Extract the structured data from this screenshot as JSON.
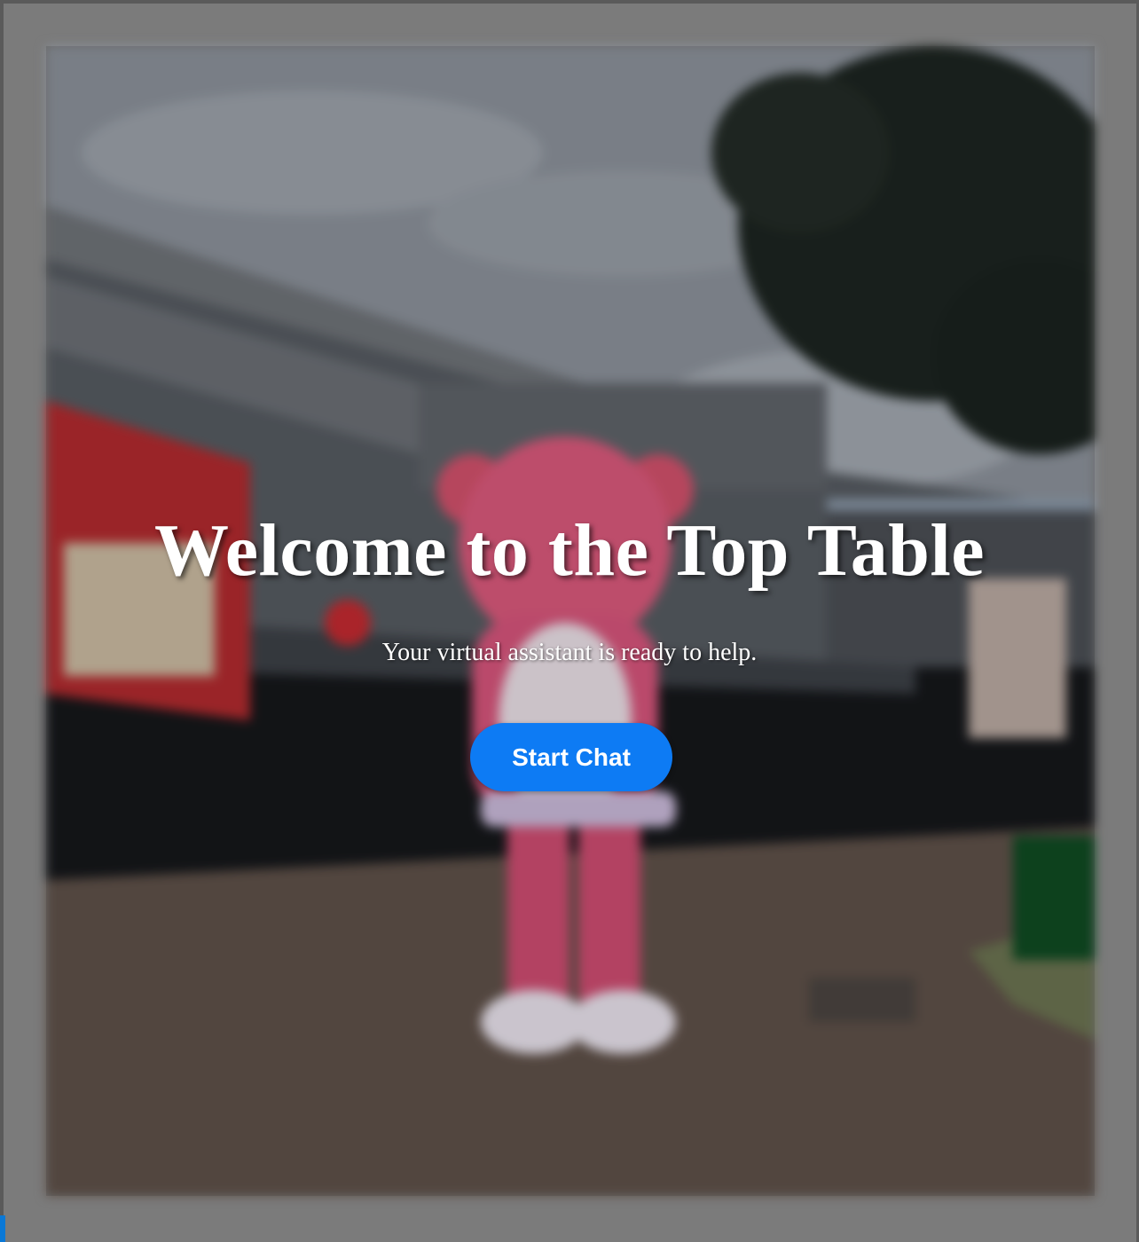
{
  "hero": {
    "title": "Welcome to the Top Table",
    "subtitle": "Your virtual assistant is ready to help.",
    "start_button_label": "Start Chat"
  },
  "colors": {
    "button_background": "#0d7bf4",
    "text": "#ffffff",
    "page_dim": "#7b7b7b"
  }
}
